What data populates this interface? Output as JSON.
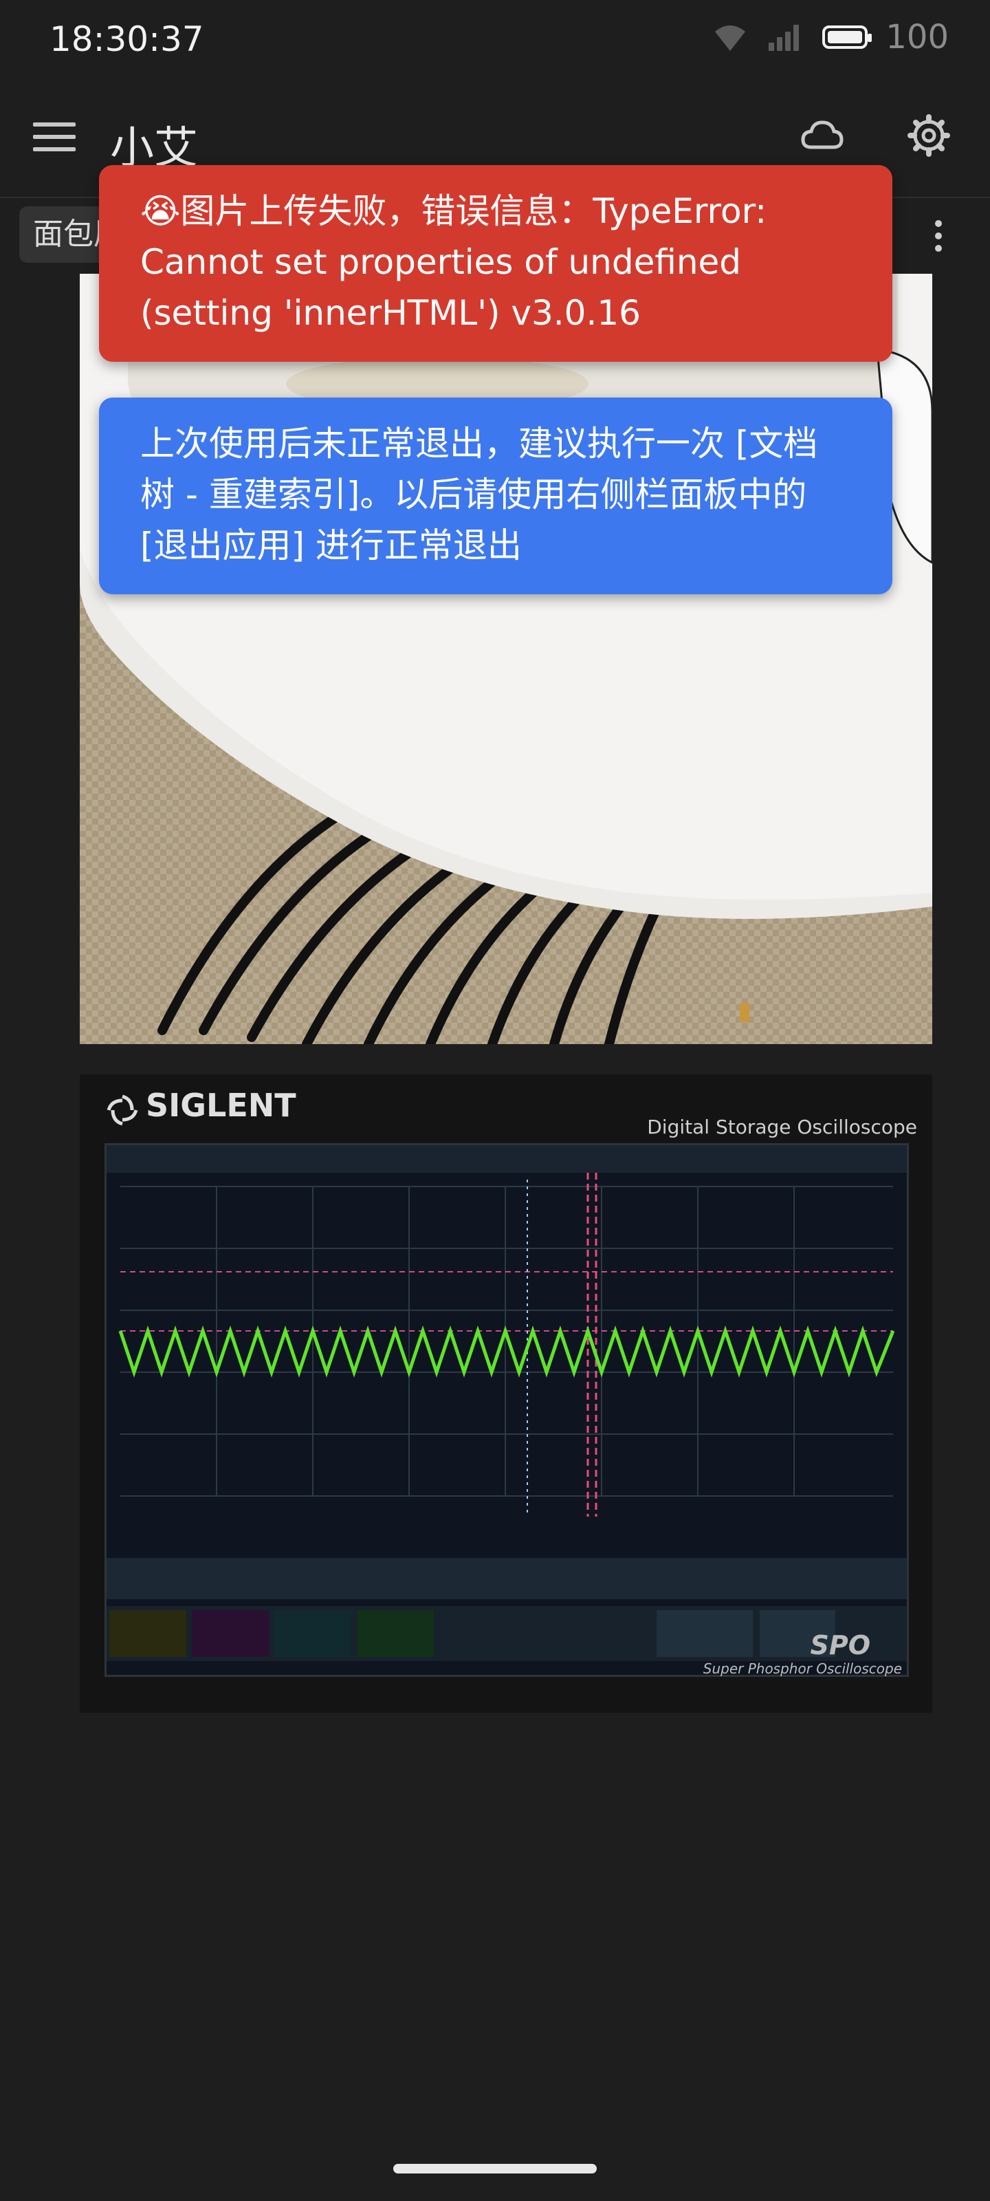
{
  "status_bar": {
    "time": "18:30:37",
    "battery": "100",
    "icons": [
      "wifi-icon",
      "signal-5g-icon",
      "battery-icon"
    ]
  },
  "app_bar": {
    "title": "小艾",
    "icons": [
      "menu-icon",
      "cloud-icon",
      "gear-icon"
    ]
  },
  "breadcrumb": {
    "label": "面包屑",
    "more_icon": "more-vert-icon"
  },
  "toasts": {
    "error": "😭图片上传失败，错误信息：TypeError: Cannot set properties of undefined (setting 'innerHTML') v3.0.16",
    "info": "上次使用后未正常退出，建议执行一次 [文档树 - 重建索引]。以后请使用右侧栏面板中的 [退出应用] 进行正常退出"
  },
  "oscilloscope": {
    "brand": "SIGLENT",
    "subtitle": "Digital Storage Oscilloscope",
    "model_mark": "SPO",
    "model_sub": "Super Phosphor Oscilloscope"
  },
  "colors": {
    "background": "#1e1e1e",
    "error_toast": "#d33a2e",
    "info_toast": "#3d78ef",
    "waveform": "#5fe32b"
  }
}
